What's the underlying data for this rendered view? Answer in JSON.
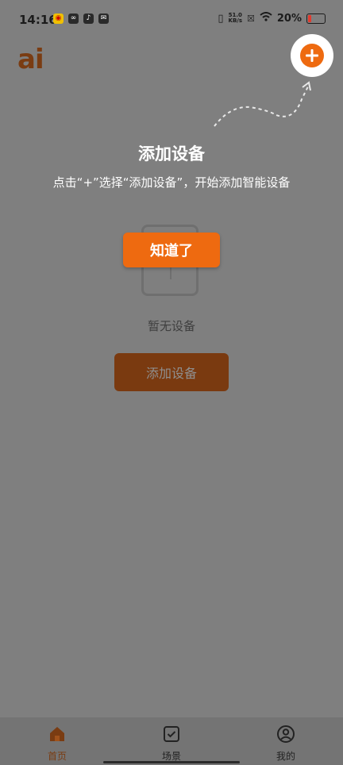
{
  "status_bar": {
    "time": "14:16",
    "network_speed_value": "51.0",
    "network_speed_unit": "KB/s",
    "battery_percent": "20%",
    "app_icons": [
      "weibo-icon",
      "link-app-icon",
      "tiktok-icon",
      "message-icon"
    ]
  },
  "header": {
    "logo": "ai"
  },
  "guide": {
    "title": "添加设备",
    "description": "点击“+”选择“添加设备”，开始添加智能设备",
    "got_it_label": "知道了"
  },
  "empty_state": {
    "message": "暂无设备",
    "add_button_label": "添加设备"
  },
  "bottom_nav": {
    "items": [
      {
        "label": "首页",
        "icon": "home-icon",
        "active": true
      },
      {
        "label": "场景",
        "icon": "scene-check-icon",
        "active": false
      },
      {
        "label": "我的",
        "icon": "profile-icon",
        "active": false
      }
    ]
  },
  "colors": {
    "accent": "#ee6a10",
    "overlay": "#7f7f7f",
    "brand_dark": "#7a3c12"
  }
}
